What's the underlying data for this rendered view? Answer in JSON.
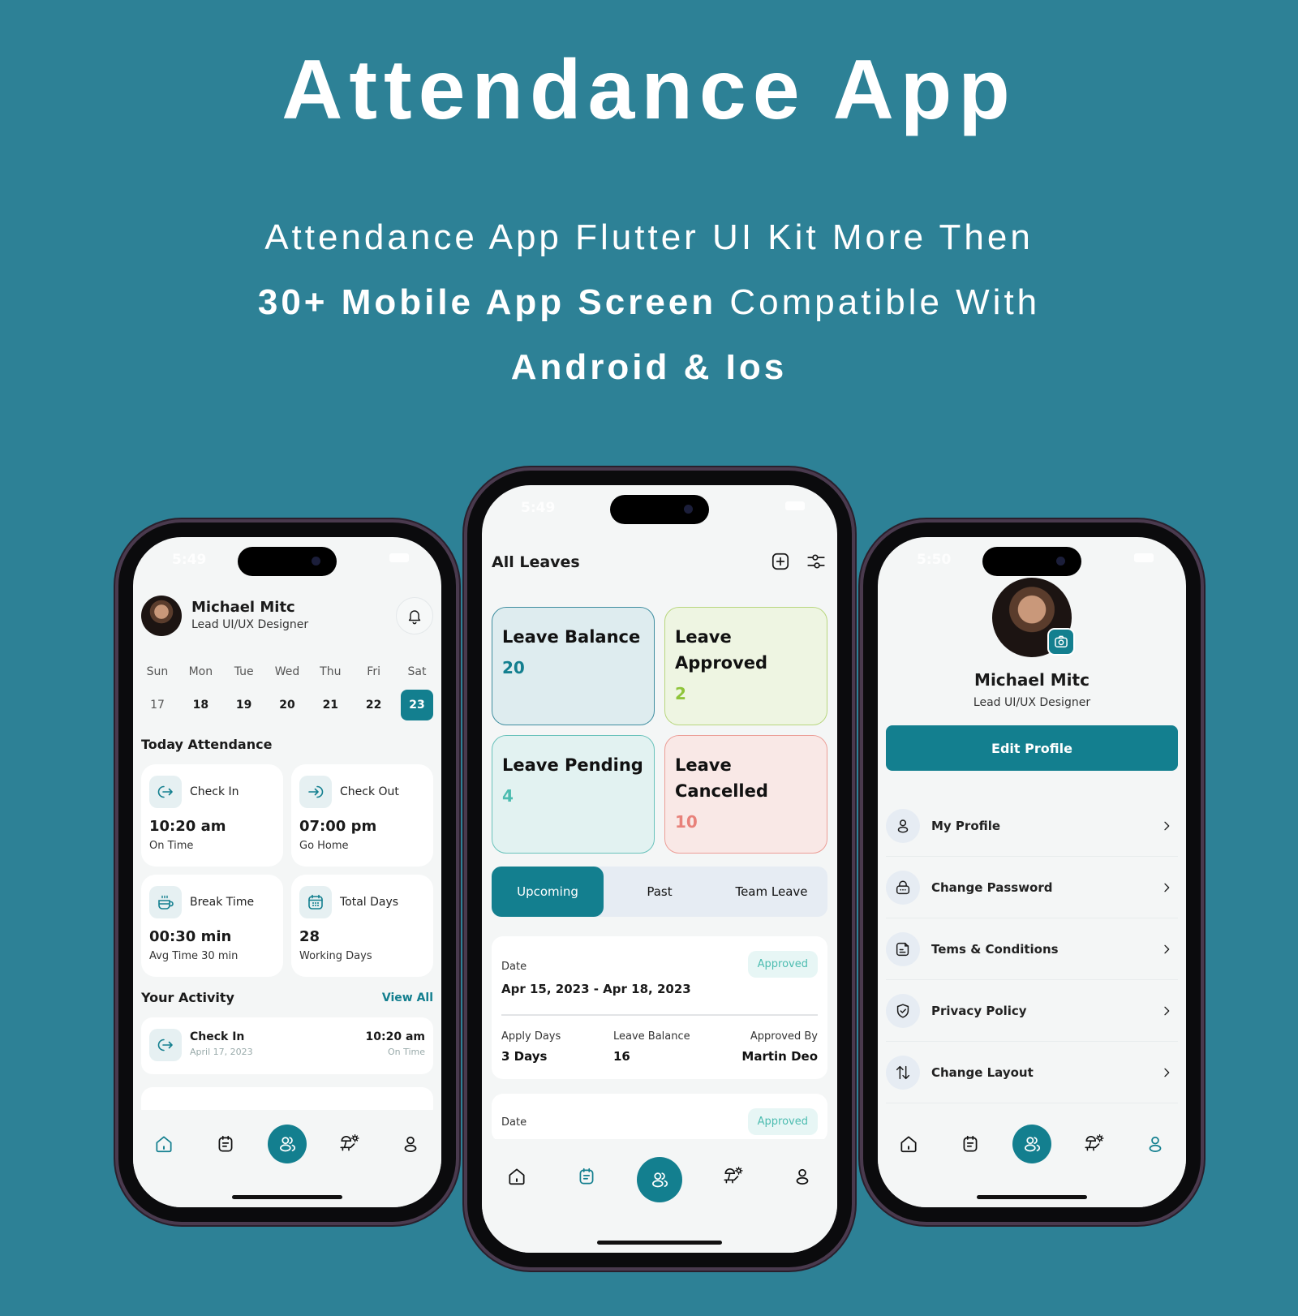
{
  "hero": {
    "title": "Attendance App",
    "line1": "Attendance App Flutter UI Kit More Then",
    "line2_bold": "30+ Mobile App Screen",
    "line2_rest": " Compatible With",
    "line3": "Android & Ios"
  },
  "colors": {
    "background": "#2d8196",
    "accent": "#137f8f",
    "approved_green": "#8fc43a",
    "cancelled_red": "#e8817a",
    "pending_teal": "#4cbcb0"
  },
  "home_screen": {
    "status_time": "5:49",
    "user": {
      "name": "Michael Mitc",
      "role": "Lead UI/UX Designer"
    },
    "calendar": [
      {
        "day": "Sun",
        "date": "17"
      },
      {
        "day": "Mon",
        "date": "18"
      },
      {
        "day": "Tue",
        "date": "19"
      },
      {
        "day": "Wed",
        "date": "20"
      },
      {
        "day": "Thu",
        "date": "21"
      },
      {
        "day": "Fri",
        "date": "22"
      },
      {
        "day": "Sat",
        "date": "23",
        "selected": true
      }
    ],
    "today_title": "Today Attendance",
    "cards": [
      {
        "icon": "check-in-icon",
        "label": "Check In",
        "value": "10:20 am",
        "sub": "On Time"
      },
      {
        "icon": "check-out-icon",
        "label": "Check Out",
        "value": "07:00 pm",
        "sub": "Go Home"
      },
      {
        "icon": "coffee-cup-icon",
        "label": "Break Time",
        "value": "00:30 min",
        "sub": "Avg Time 30 min"
      },
      {
        "icon": "calendar-icon",
        "label": "Total Days",
        "value": "28",
        "sub": "Working Days"
      }
    ],
    "activity_title": "Your Activity",
    "view_all": "View All",
    "activity": [
      {
        "icon": "check-in-icon",
        "title": "Check In",
        "date": "April 17, 2023",
        "time": "10:20 am",
        "status": "On Time"
      }
    ],
    "active_nav": "home"
  },
  "leaves_screen": {
    "status_time": "5:49",
    "title": "All Leaves",
    "stats": [
      {
        "label": "Leave Balance",
        "value": "20"
      },
      {
        "label": "Leave Approved",
        "value": "2"
      },
      {
        "label": "Leave Pending",
        "value": "4"
      },
      {
        "label": "Leave Cancelled",
        "value": "10"
      }
    ],
    "tabs": [
      "Upcoming",
      "Past",
      "Team Leave"
    ],
    "active_tab": "Upcoming",
    "leaves": [
      {
        "date_label": "Date",
        "range": "Apr 15, 2023 - Apr 18, 2023",
        "status": "Approved",
        "apply_days_label": "Apply Days",
        "apply_days": "3 Days",
        "balance_label": "Leave Balance",
        "balance": "16",
        "approved_by_label": "Approved By",
        "approved_by": "Martin Deo"
      },
      {
        "date_label": "Date",
        "status": "Approved"
      }
    ],
    "active_nav": "calendar"
  },
  "profile_screen": {
    "status_time": "5:50",
    "user": {
      "name": "Michael Mitc",
      "role": "Lead UI/UX Designer"
    },
    "edit_button": "Edit Profile",
    "menu": [
      {
        "icon": "user-icon",
        "label": "My Profile"
      },
      {
        "icon": "lock-icon",
        "label": "Change Password"
      },
      {
        "icon": "document-icon",
        "label": "Tems & Conditions"
      },
      {
        "icon": "shield-check-icon",
        "label": "Privacy Policy"
      },
      {
        "icon": "swap-vertical-icon",
        "label": "Change Layout"
      }
    ],
    "active_nav": "profile"
  },
  "bottom_nav": [
    "home",
    "calendar",
    "team",
    "holiday",
    "profile"
  ]
}
